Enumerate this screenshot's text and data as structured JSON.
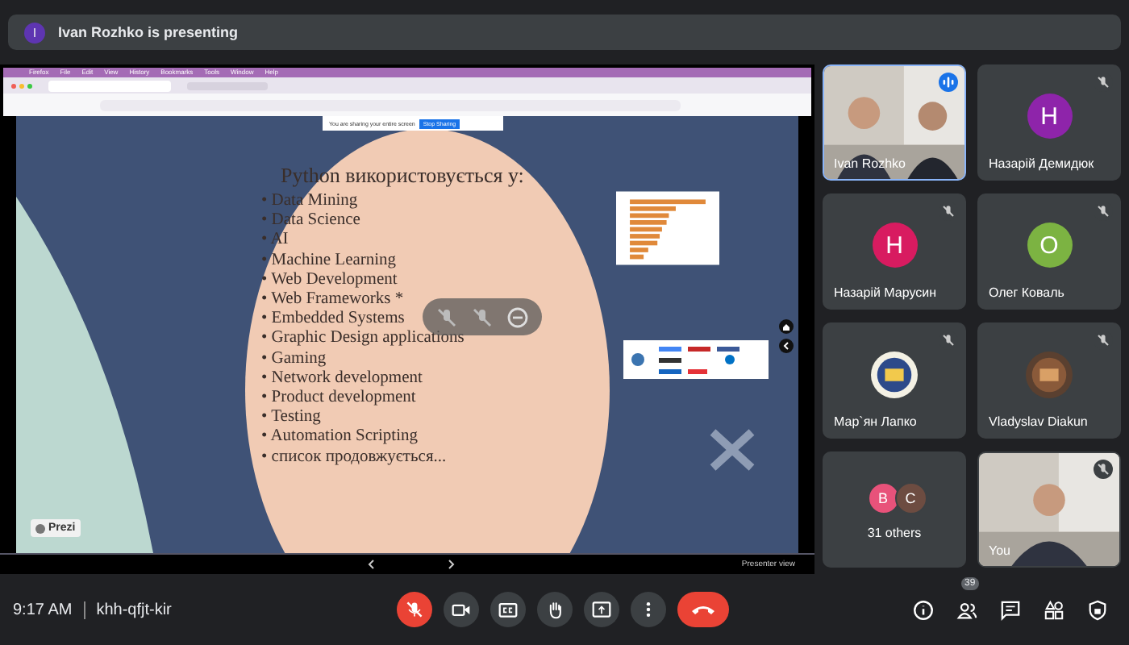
{
  "banner": {
    "avatar_letter": "I",
    "text": "Ivan Rozhko is presenting"
  },
  "shared_screen": {
    "menu_bar": [
      "Firefox",
      "File",
      "Edit",
      "View",
      "History",
      "Bookmarks",
      "Tools",
      "Window",
      "Help"
    ],
    "sharing_notice": "You are sharing your entire screen",
    "stop_button": "Stop Sharing",
    "slide": {
      "title": "Python використовується у:",
      "items": [
        "• Data Mining",
        "• Data Science",
        "• AI",
        "• Machine Learning",
        "• Web Development",
        "• Web Frameworks *",
        "• Embedded Systems",
        "• Graphic Design applications",
        "• Gaming",
        "• Network development",
        "• Product development",
        "• Testing",
        "• Automation Scripting",
        "• список продовжується..."
      ],
      "brand": "Prezi"
    },
    "presenter_view": "Presenter view"
  },
  "tiles": [
    {
      "kind": "video",
      "name": "Ivan Rozhko",
      "speaking": true,
      "muted": false
    },
    {
      "kind": "letter",
      "letter": "Н",
      "color": "#8e24aa",
      "name": "Назарій Демидюк",
      "speaking": false,
      "muted": true
    },
    {
      "kind": "letter",
      "letter": "Н",
      "color": "#d81b60",
      "name": "Назарій Марусин",
      "speaking": false,
      "muted": true
    },
    {
      "kind": "letter",
      "letter": "О",
      "color": "#7cb342",
      "name": "Олег Коваль",
      "speaking": false,
      "muted": true
    },
    {
      "name": "Мар`ян Лапко",
      "speaking": false,
      "muted": true
    },
    {
      "name": "Vladyslav Diakun",
      "speaking": false,
      "muted": true
    },
    {
      "kind": "others",
      "avatars": [
        {
          "letter": "B",
          "color": "#e8527a"
        },
        {
          "letter": "C",
          "color": "#6d4c41"
        }
      ],
      "name": "31 others",
      "speaking": false,
      "muted": false
    },
    {
      "kind": "video",
      "name": "You",
      "speaking": false,
      "muted": true
    }
  ],
  "bottom_bar": {
    "time": "9:17 AM",
    "meeting_code": "khh-qfjt-kir",
    "mic_muted": true,
    "people_count": "39"
  }
}
